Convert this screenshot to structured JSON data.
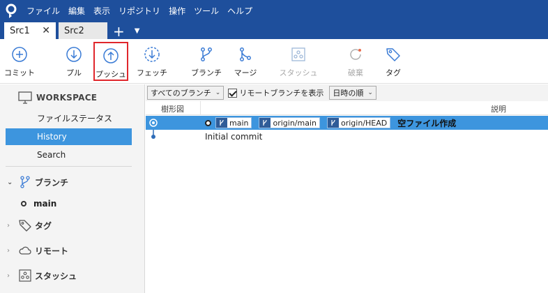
{
  "menu": {
    "items": [
      "ファイル",
      "編集",
      "表示",
      "リポジトリ",
      "操作",
      "ツール",
      "ヘルプ"
    ]
  },
  "tabs": [
    {
      "label": "Src1",
      "active": true
    },
    {
      "label": "Src2",
      "active": false
    }
  ],
  "toolbar": {
    "commit": "コミット",
    "pull": "プル",
    "push": "プッシュ",
    "fetch": "フェッチ",
    "branch": "ブランチ",
    "merge": "マージ",
    "stash": "スタッシュ",
    "discard": "破棄",
    "tag": "タグ"
  },
  "sidebar": {
    "workspace_title": "WORKSPACE",
    "items": [
      {
        "label": "ファイルステータス"
      },
      {
        "label": "History",
        "selected": true
      },
      {
        "label": "Search"
      }
    ],
    "sections": {
      "branches": "ブランチ",
      "tags": "タグ",
      "remotes": "リモート",
      "stashes": "スタッシュ"
    },
    "current_branch": "main"
  },
  "filter": {
    "branches_dropdown": "すべてのブランチ",
    "show_remote_label": "リモートブランチを表示",
    "sort_dropdown": "日時の順"
  },
  "columns": {
    "graph": "樹形図",
    "description": "説明"
  },
  "commits": [
    {
      "refs": [
        "main",
        "origin/main",
        "origin/HEAD"
      ],
      "message": "空ファイル作成"
    },
    {
      "refs": [],
      "message": "Initial commit"
    }
  ],
  "colors": {
    "titlebar": "#1e4f9c",
    "selection": "#3d95de",
    "icon": "#3a7bd5",
    "highlight_border": "#e0262b"
  }
}
